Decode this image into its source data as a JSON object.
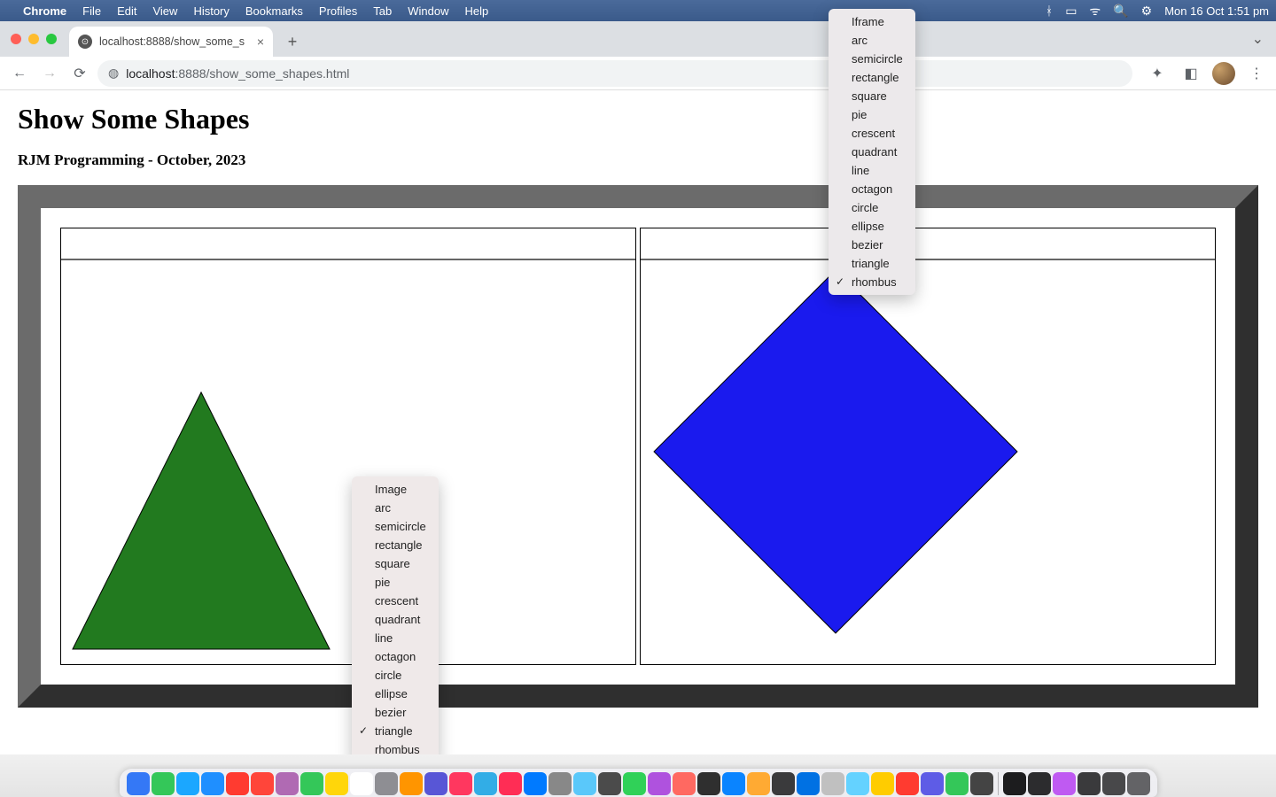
{
  "menubar": {
    "app": "Chrome",
    "items": [
      "File",
      "Edit",
      "View",
      "History",
      "Bookmarks",
      "Profiles",
      "Tab",
      "Window",
      "Help"
    ],
    "clock": "Mon 16 Oct  1:51 pm"
  },
  "tab": {
    "title": "localhost:8888/show_some_s"
  },
  "omnibox": {
    "host": "localhost",
    "port_path": ":8888/show_some_shapes.html"
  },
  "page": {
    "h1": "Show Some Shapes",
    "h3": "RJM Programming - October, 2023"
  },
  "popup_left": {
    "items": [
      "Image",
      "arc",
      "semicircle",
      "rectangle",
      "square",
      "pie",
      "crescent",
      "quadrant",
      "line",
      "octagon",
      "circle",
      "ellipse",
      "bezier",
      "triangle",
      "rhombus"
    ],
    "checked": "triangle"
  },
  "popup_right": {
    "items": [
      "Iframe",
      "arc",
      "semicircle",
      "rectangle",
      "square",
      "pie",
      "crescent",
      "quadrant",
      "line",
      "octagon",
      "circle",
      "ellipse",
      "bezier",
      "triangle",
      "rhombus"
    ],
    "checked": "rhombus"
  },
  "shapes": {
    "left": {
      "type": "triangle",
      "fill": "#227a1f"
    },
    "right": {
      "type": "rhombus",
      "fill": "#1a1aee"
    }
  },
  "dock_colors": [
    "#3478f6",
    "#34c759",
    "#1ba7ff",
    "#1f8fff",
    "#ff3b30",
    "#ff453a",
    "#b06ab3",
    "#34c759",
    "#ffd60a",
    "#ffffff",
    "#8e8e93",
    "#ff9500",
    "#5856d6",
    "#ff375f",
    "#32ade6",
    "#ff2d55",
    "#007aff",
    "#888888",
    "#5ac8fa",
    "#4b4b4b",
    "#30d158",
    "#af52de",
    "#ff6961",
    "#2f2f2f",
    "#0a84ff",
    "#ffaa33",
    "#3a3a3c",
    "#0071e3",
    "#c0c0c0",
    "#64d2ff",
    "#ffcc00",
    "#ff3b30",
    "#5e5ce6",
    "#34c759",
    "#444444",
    "#1c1c1e",
    "#2c2c2e",
    "#bf5af2",
    "#3a3a3c",
    "#48484a",
    "#636366"
  ]
}
